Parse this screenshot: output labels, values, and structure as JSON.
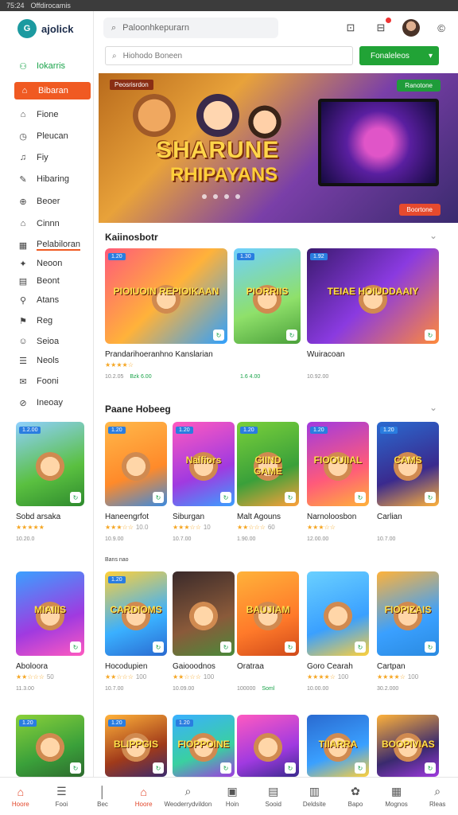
{
  "status": {
    "left": "75:24",
    "center": "Offdirocamis",
    "right": ""
  },
  "app": {
    "logo_text": "ajolick",
    "logo_mark": "G"
  },
  "sidebar": {
    "items": [
      {
        "label": "Iokarris",
        "icon": "gamepad-icon",
        "glyph": "⚇",
        "style": "green"
      },
      {
        "label": "Bibaran",
        "icon": "home-icon",
        "glyph": "⌂",
        "style": "active"
      },
      {
        "label": "Fione",
        "icon": "home-outline-icon",
        "glyph": "⌂",
        "style": ""
      },
      {
        "label": "Pleucan",
        "icon": "clock-icon",
        "glyph": "◷",
        "style": ""
      },
      {
        "label": "Fiy",
        "icon": "bell-icon",
        "glyph": "♫",
        "style": ""
      },
      {
        "label": "Hibaring",
        "icon": "tag-icon",
        "glyph": "✎",
        "style": ""
      },
      {
        "label": "Beoer",
        "icon": "info-icon",
        "glyph": "⊕",
        "style": ""
      },
      {
        "label": "Cinnn",
        "icon": "home-small-icon",
        "glyph": "⌂",
        "style": ""
      },
      {
        "label": "Pelabiloran",
        "icon": "grid-icon",
        "glyph": "▦",
        "style": "underline"
      },
      {
        "label": "Neoon",
        "icon": "sparkle-icon",
        "glyph": "✦",
        "style": ""
      },
      {
        "label": "Beont",
        "icon": "doc-icon",
        "glyph": "▤",
        "style": ""
      },
      {
        "label": "Atans",
        "icon": "pin-icon",
        "glyph": "⚲",
        "style": ""
      },
      {
        "label": "Reg",
        "icon": "flag-icon",
        "glyph": "⚑",
        "style": ""
      },
      {
        "label": "Seioa",
        "icon": "people-icon",
        "glyph": "☺",
        "style": ""
      },
      {
        "label": "Neols",
        "icon": "list-icon",
        "glyph": "☰",
        "style": ""
      },
      {
        "label": "Fooni",
        "icon": "chat-icon",
        "glyph": "✉",
        "style": ""
      },
      {
        "label": "Ineoay",
        "icon": "link-icon",
        "glyph": "⊘",
        "style": ""
      }
    ]
  },
  "topbar": {
    "search_placeholder": "Paloonhkepurarn",
    "search2_placeholder": "Hiohodo Boneen",
    "green_button": "Fonaleleos"
  },
  "banner": {
    "tag_left": "Peosrisrdon",
    "tag_right": "Ranotone",
    "title": "SHARUNE",
    "subtitle": "RHIPAYANS",
    "cta": "Boortone"
  },
  "featured": {
    "title": "Kaiinosbotr",
    "cards": [
      {
        "name": "Prandarihoeranhno Kanslarian",
        "rating": "★★★★☆",
        "meta": "10.2.05",
        "meta_green": "Bzk 6.00",
        "thumb_text": "PIOIUOIN REPIOIKAAN",
        "label": "1.20",
        "bg": "linear-gradient(135deg,#ff5a7a,#ffb23a 50%,#2ea0ff)"
      },
      {
        "name": "",
        "rating": "",
        "meta": "",
        "meta_green": "1.6 4.00",
        "thumb_text": "PIORRIIS",
        "label": "1.30",
        "bg": "linear-gradient(160deg,#6fd0ff,#8fe06a 60%,#4aa03a)"
      },
      {
        "name": "Wuiracoan",
        "rating": "",
        "meta": "10.92.00",
        "meta_green": "",
        "thumb_text": "TEIAE HOIUDDAAIY",
        "label": "1.92",
        "bg": "linear-gradient(135deg,#3a1a6e,#8a3ae0 50%,#ff8a3a)"
      }
    ]
  },
  "section2": {
    "title": "Paane Hobeeg",
    "cards": [
      {
        "name": "Sobd arsaka",
        "rating": "★★★★★",
        "rating_value": "",
        "meta": "10.20.0",
        "meta_green": "",
        "thumb_text": "",
        "label": "1.2.00",
        "bg": "linear-gradient(160deg,#8fd0ff,#5ac040 60%,#2e8a2e)"
      },
      {
        "name": "Haneengrfot",
        "rating": "★★★☆☆",
        "rating_value": "10.0",
        "meta": "10.9.00",
        "meta_green": "",
        "thumb_text": "",
        "label": "1.20",
        "bg": "linear-gradient(160deg,#ffb84a,#ff8a2a 60%,#3a8ae0)"
      },
      {
        "name": "Siburgan",
        "rating": "★★★☆☆",
        "rating_value": "10",
        "meta": "10.7.00",
        "meta_green": "",
        "thumb_text": "Nalfiors",
        "label": "1.20",
        "bg": "linear-gradient(160deg,#ff5ac0,#a03ae0 60%,#3aa0ff)"
      },
      {
        "name": "Malt Agouns",
        "rating": "★★☆☆☆",
        "rating_value": "60",
        "meta": "1.90.00",
        "meta_green": "",
        "thumb_text": "GIIND GAME",
        "label": "1.20",
        "bg": "linear-gradient(160deg,#7ad03a,#3aa03a 60%,#ffa03a)"
      },
      {
        "name": "Narnoloosbon",
        "rating": "★★★☆☆",
        "rating_value": "",
        "meta": "12.00.00",
        "meta_green": "",
        "thumb_text": "FIOOUIIAL",
        "label": "1.20",
        "bg": "linear-gradient(160deg,#a03ae0,#ff5a7a 60%,#ffb23a)"
      },
      {
        "name": "Carlian",
        "rating": "",
        "rating_value": "",
        "meta": "10.7.00",
        "meta_green": "",
        "thumb_text": "CAMS",
        "label": "1.20",
        "bg": "linear-gradient(160deg,#2a6ad0,#3a2a8e 60%,#ffb23a)"
      }
    ],
    "note": "Bans nao"
  },
  "section3": {
    "cards": [
      {
        "name": "Aboloora",
        "rating": "★★☆☆☆",
        "rating_value": "50",
        "meta": "11.3.00",
        "meta_green": "",
        "thumb_text": "MIAIIIS",
        "label": "",
        "bg": "linear-gradient(160deg,#3aa0ff,#a03ae0 60%,#ff5ac0)"
      },
      {
        "name": "Hocodupien",
        "rating": "★★☆☆☆",
        "rating_value": "100",
        "meta": "10.7.00",
        "meta_green": "",
        "thumb_text": "CARDIOMS",
        "label": "1.20",
        "bg": "linear-gradient(160deg,#ffd03a,#3ab0ff 60%,#2a6ad0)"
      },
      {
        "name": "Gaiooodnos",
        "rating": "★★☆☆☆",
        "rating_value": "100",
        "meta": "10.09.00",
        "meta_green": "",
        "thumb_text": "",
        "label": "",
        "bg": "linear-gradient(160deg,#3a2a2a,#8a5a3a 60%,#4a8a3a)"
      },
      {
        "name": "Oratraa",
        "rating": "",
        "rating_value": "",
        "meta": "100000",
        "meta_green": "Soml",
        "thumb_text": "BAUJIAM",
        "label": "",
        "bg": "linear-gradient(160deg,#ffb23a,#ff7a2a 60%,#d04a1a)"
      },
      {
        "name": "Goro Cearah",
        "rating": "★★★★☆",
        "rating_value": "100",
        "meta": "10.00.00",
        "meta_green": "",
        "thumb_text": "",
        "label": "",
        "bg": "linear-gradient(160deg,#6ad0ff,#3aa0ff 60%,#ffd03a)"
      },
      {
        "name": "Cartpan",
        "rating": "★★★★☆",
        "rating_value": "100",
        "meta": "30.2.000",
        "meta_green": "",
        "thumb_text": "FIOPIZAIS",
        "label": "",
        "bg": "linear-gradient(160deg,#ffb23a,#3aa0ff 60%,#2a8ae0)"
      }
    ]
  },
  "section4": {
    "cards": [
      {
        "label": "1.20",
        "bg": "linear-gradient(160deg,#8ad03a,#3aa03a 60%,#2e6a2e)",
        "thumb_text": ""
      },
      {
        "label": "1.20",
        "bg": "linear-gradient(160deg,#ffb23a,#a03a1a 60%,#3a2a6e)",
        "thumb_text": "BLIPPGIS"
      },
      {
        "label": "1.20",
        "bg": "linear-gradient(160deg,#3ab0ff,#3ad0a0 60%,#a03ae0)",
        "thumb_text": "FIOPPOINE"
      },
      {
        "label": "",
        "bg": "linear-gradient(160deg,#ff5ac0,#a03ae0 60%,#3a2a8e)",
        "thumb_text": ""
      },
      {
        "label": "",
        "bg": "linear-gradient(160deg,#2a6ad0,#3aa0ff 60%,#ffd03a)",
        "thumb_text": "TIIARRA"
      },
      {
        "label": "",
        "bg": "linear-gradient(160deg,#ffb23a,#3a2a6e 60%,#a03ae0)",
        "thumb_text": "BOOPIVIAS"
      }
    ]
  },
  "bottomnav": {
    "items": [
      {
        "label": "Hoore",
        "icon": "home-icon",
        "glyph": "⌂",
        "active": true
      },
      {
        "label": "Fooi",
        "icon": "menu-icon",
        "glyph": "☰",
        "active": false
      },
      {
        "label": "Bec",
        "icon": "divider-icon",
        "glyph": "│",
        "active": false
      },
      {
        "label": "Hoore",
        "icon": "home-outline-icon",
        "glyph": "⌂",
        "active": true
      },
      {
        "label": "Weoderrydvildon",
        "icon": "search-icon",
        "glyph": "⌕",
        "active": false
      },
      {
        "label": "Hoin",
        "icon": "store-icon",
        "glyph": "▣",
        "active": false
      },
      {
        "label": "Sooid",
        "icon": "doc-icon",
        "glyph": "▤",
        "active": false
      },
      {
        "label": "Deldsite",
        "icon": "chart-icon",
        "glyph": "▥",
        "active": false
      },
      {
        "label": "Bapo",
        "icon": "gift-icon",
        "glyph": "✿",
        "active": false
      },
      {
        "label": "Mognos",
        "icon": "grid-icon",
        "glyph": "▦",
        "active": false
      },
      {
        "label": "Rleas",
        "icon": "search-alt-icon",
        "glyph": "⌕",
        "active": false
      }
    ]
  },
  "colors": {
    "accent": "#f05a22",
    "green": "#21a336",
    "star": "#f5a623"
  }
}
